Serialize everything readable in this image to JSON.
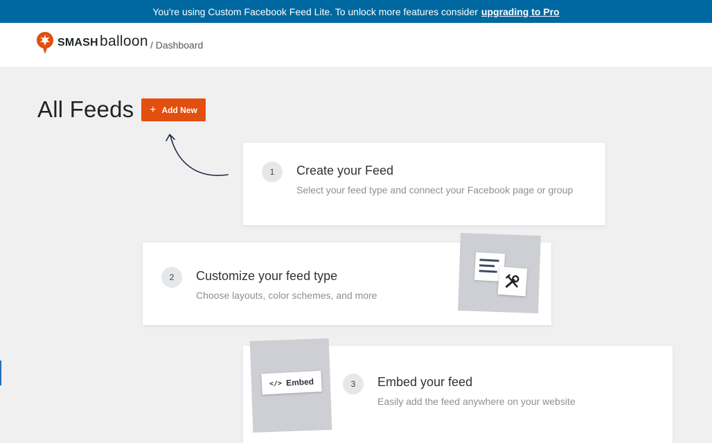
{
  "notice": {
    "text": "You're using Custom Facebook Feed Lite. To unlock more features consider",
    "link": "upgrading to Pro"
  },
  "header": {
    "brand_smash": "SMASH",
    "brand_balloon": "balloon",
    "breadcrumb": "/ Dashboard"
  },
  "page": {
    "title": "All Feeds",
    "add_new_label": "Add New"
  },
  "steps": [
    {
      "number": "1",
      "title": "Create your Feed",
      "description": "Select your feed type and connect your Facebook page or group"
    },
    {
      "number": "2",
      "title": "Customize your feed type",
      "description": "Choose layouts, color schemes, and more"
    },
    {
      "number": "3",
      "title": "Embed your feed",
      "description": "Easily add the feed anywhere on your website"
    }
  ],
  "illustrations": {
    "embed_code": "</>",
    "embed_label": "Embed"
  },
  "colors": {
    "notice_bg": "#0068a0",
    "accent": "#e34f0e",
    "page_bg": "#f0f0f1",
    "illustration_bg": "#cdcfd4"
  },
  "icons": [
    "smash-balloon-logo-icon",
    "plus-icon",
    "curved-arrow-icon",
    "document-lines-icon",
    "tools-icon",
    "code-icon"
  ]
}
